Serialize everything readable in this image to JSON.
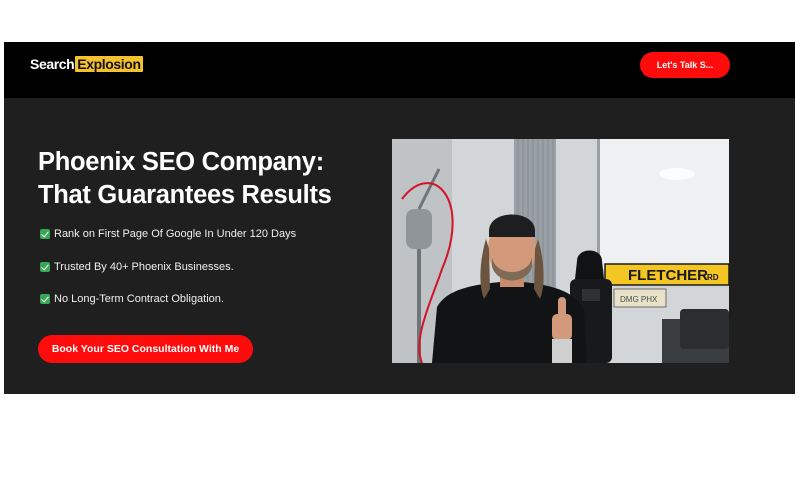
{
  "header": {
    "logo_part1": "Search",
    "logo_part2": "Explosion",
    "cta_label": "Let's Talk S..."
  },
  "hero": {
    "title_line1": "Phoenix SEO Company:",
    "title_line2": "That Guarantees Results",
    "bullets": [
      "Rank on First Page Of Google In Under 120 Days",
      "Trusted By 40+ Phoenix Businesses.",
      "No Long-Term Contract Obligation."
    ],
    "cta_label": "Book Your SEO Consultation With Me"
  },
  "video": {
    "sign_main": "FLETCHER",
    "sign_suffix": "RD",
    "plate_text": "DMG PHX"
  },
  "colors": {
    "accent_red": "#ff0b0b",
    "logo_yellow": "#f6c12e",
    "hero_bg": "#1f1f1f",
    "header_bg": "#000000",
    "check_green": "#3aa757"
  }
}
